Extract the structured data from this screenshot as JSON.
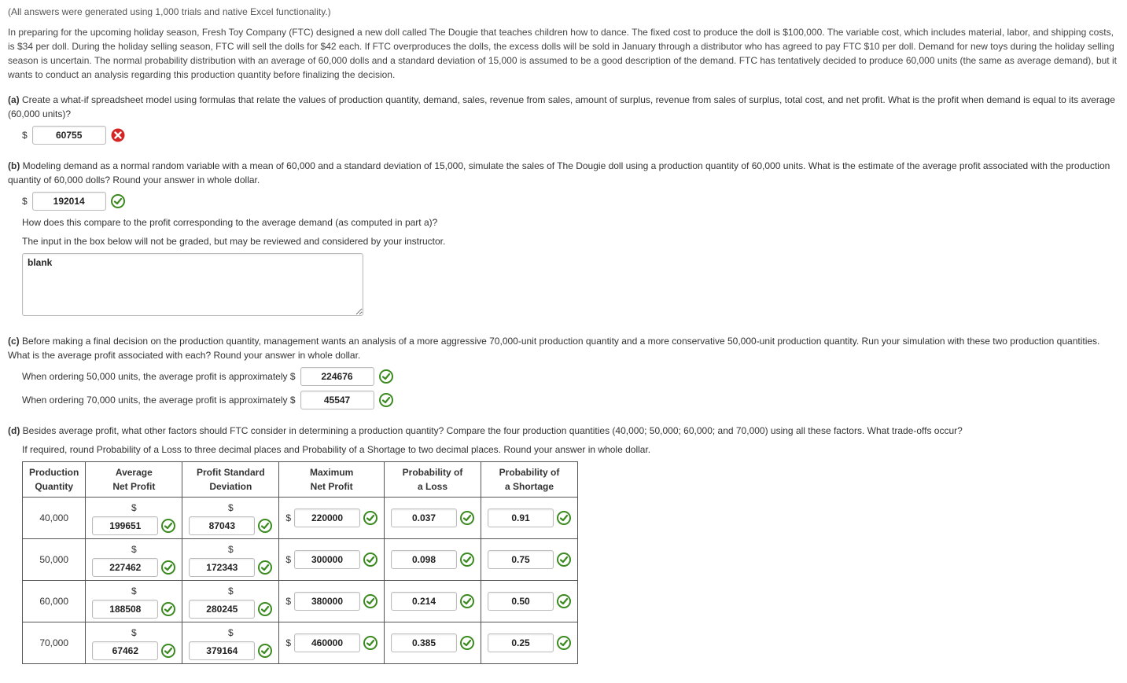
{
  "note": "(All answers were generated using 1,000 trials and native Excel functionality.)",
  "intro": "In preparing for the upcoming holiday season, Fresh Toy Company (FTC) designed a new doll called The Dougie that teaches children how to dance. The fixed cost to produce the doll is $100,000. The variable cost, which includes material, labor, and shipping costs, is $34 per doll. During the holiday selling season, FTC will sell the dolls for $42 each. If FTC overproduces the dolls, the excess dolls will be sold in January through a distributor who has agreed to pay FTC $10 per doll. Demand for new toys during the holiday selling season is uncertain. The normal probability distribution with an average of 60,000 dolls and a standard deviation of 15,000 is assumed to be a good description of the demand. FTC has tentatively decided to produce 60,000 units (the same as average demand), but it wants to conduct an analysis regarding this production quantity before finalizing the decision.",
  "dollar": "$",
  "a": {
    "label": "(a)",
    "text": "Create a what-if spreadsheet model using formulas that relate the values of production quantity, demand, sales, revenue from sales, amount of surplus, revenue from sales of surplus, total cost, and net profit. What is the profit when demand is equal to its average (60,000 units)?",
    "value": "60755",
    "status": "incorrect"
  },
  "b": {
    "label": "(b)",
    "text": "Modeling demand as a normal random variable with a mean of 60,000 and a standard deviation of 15,000, simulate the sales of The Dougie doll using a production quantity of 60,000 units. What is the estimate of the average profit associated with the production quantity of 60,000 dolls? Round your answer in whole dollar.",
    "value": "192014",
    "status": "correct",
    "compare": "How does this compare to the profit corresponding to the average demand (as computed in part a)?",
    "note": "The input in the box below will not be graded, but may be reviewed and considered by your instructor.",
    "free": "blank"
  },
  "c": {
    "label": "(c)",
    "text": "Before making a final decision on the production quantity, management wants an analysis of a more aggressive 70,000-unit production quantity and a more conservative 50,000-unit production quantity. Run your simulation with these two production quantities. What is the average profit associated with each? Round your answer in whole dollar.",
    "line1": "When ordering 50,000 units, the average profit is approximately $",
    "val1": "224676",
    "line2": "When ordering 70,000 units, the average profit is approximately $",
    "val2": "45547"
  },
  "d": {
    "label": "(d)",
    "text": "Besides average profit, what other factors should FTC consider in determining a production quantity? Compare the four production quantities (40,000; 50,000; 60,000; and 70,000) using all these factors. What trade-offs occur?",
    "round": "If required, round Probability of a Loss to three decimal places and Probability of a Shortage to two decimal places. Round your answer in whole dollar.",
    "headers": {
      "qty": "Production\nQuantity",
      "avg": "Average\nNet Profit",
      "std": "Profit Standard\nDeviation",
      "max": "Maximum\nNet Profit",
      "loss": "Probability of\na Loss",
      "short": "Probability of\na Shortage"
    },
    "rows": [
      {
        "qty": "40,000",
        "avg": "199651",
        "std": "87043",
        "max": "220000",
        "loss": "0.037",
        "short": "0.91"
      },
      {
        "qty": "50,000",
        "avg": "227462",
        "std": "172343",
        "max": "300000",
        "loss": "0.098",
        "short": "0.75"
      },
      {
        "qty": "60,000",
        "avg": "188508",
        "std": "280245",
        "max": "380000",
        "loss": "0.214",
        "short": "0.50"
      },
      {
        "qty": "70,000",
        "avg": "67462",
        "std": "379164",
        "max": "460000",
        "loss": "0.385",
        "short": "0.25"
      }
    ]
  }
}
